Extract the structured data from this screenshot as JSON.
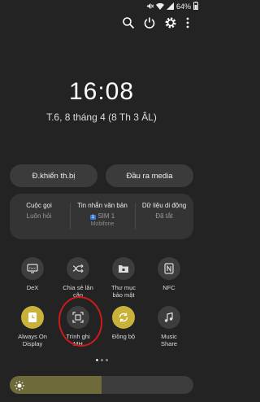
{
  "status_bar": {
    "battery": "64%"
  },
  "clock": {
    "time": "16:08",
    "date": "T.6, 8 tháng 4 (8 Th 3 ÂL)"
  },
  "buttons": {
    "device_control": "Đ.khiển th.bị",
    "media_output": "Đầu ra media"
  },
  "info_card": {
    "calls": {
      "title": "Cuộc gọi",
      "value": "Luôn hỏi"
    },
    "messages": {
      "title": "Tin nhắn văn bản",
      "value": "SIM 1",
      "sim_badge": "1",
      "carrier": "Mobifone"
    },
    "mobile_data": {
      "title": "Dữ liệu di động",
      "value": "Đã tắt"
    }
  },
  "tiles": [
    {
      "label": "DeX",
      "icon": "dex-icon",
      "state": "off"
    },
    {
      "label": "Chia sẻ lân cận",
      "icon": "nearby-share-icon",
      "state": "off"
    },
    {
      "label": "Thư mục bảo mật",
      "icon": "secure-folder-icon",
      "state": "off"
    },
    {
      "label": "NFC",
      "icon": "nfc-icon",
      "state": "off"
    },
    {
      "label": "Always On Display",
      "icon": "always-on-display-icon",
      "state": "on"
    },
    {
      "label": "Trình ghi MH",
      "icon": "screen-recorder-icon",
      "state": "off"
    },
    {
      "label": "Đồng bộ",
      "icon": "sync-icon",
      "state": "on"
    },
    {
      "label": "Music Share",
      "icon": "music-share-icon",
      "state": "off"
    }
  ],
  "brightness": {
    "level": 0.5
  },
  "colors": {
    "accent": "#c9b23a",
    "annotation": "#d01a1a"
  }
}
